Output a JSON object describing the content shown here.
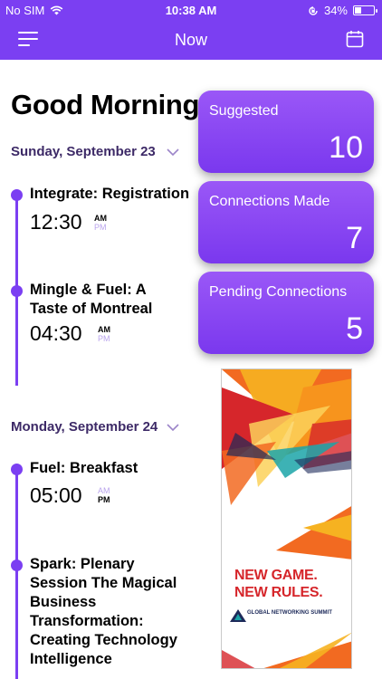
{
  "status_bar": {
    "carrier": "No SIM",
    "time": "10:38 AM",
    "battery": "34%",
    "battery_level": 0.34,
    "icons": [
      "wifi-icon",
      "orientation-lock-icon",
      "battery-icon"
    ]
  },
  "nav": {
    "title": "Now",
    "left_icon": "hamburger-menu-icon",
    "right_icon": "calendar-icon"
  },
  "greeting": "Good Morning",
  "days": [
    {
      "label": "Sunday, September 23",
      "events": [
        {
          "title": "Integrate: Registration",
          "time": "12:30",
          "am": "AM",
          "pm": "PM",
          "period": "AM"
        },
        {
          "title": "Mingle & Fuel:  A Taste of Montreal",
          "time": "04:30",
          "am": "AM",
          "pm": "PM",
          "period": "AM"
        }
      ]
    },
    {
      "label": "Monday, September 24",
      "events": [
        {
          "title": "Fuel: Breakfast",
          "time": "05:00",
          "am": "AM",
          "pm": "PM",
          "period": "PM"
        },
        {
          "title": "Spark:  Plenary Session The Magical Business Transformation: Creating Technology Intelligence",
          "time": "",
          "am": "",
          "pm": "",
          "period": ""
        }
      ]
    }
  ],
  "cards": [
    {
      "label": "Suggested",
      "value": "10"
    },
    {
      "label": "Connections Made",
      "value": "7"
    },
    {
      "label": "Pending Connections",
      "value": "5"
    }
  ],
  "ad": {
    "headline_line1": "NEW GAME.",
    "headline_line2": "NEW RULES.",
    "brand": "GLOBAL NETWORKING SUMMIT",
    "colors": {
      "orange": "#f26a21",
      "red": "#d6262b",
      "yellow": "#f6b221",
      "navy": "#1d2a5a",
      "teal": "#1ba4a8"
    }
  },
  "theme": {
    "accent": "#7b3ff2",
    "day_label": "#3d2a67",
    "ampm_inactive": "#b9a3ec"
  }
}
